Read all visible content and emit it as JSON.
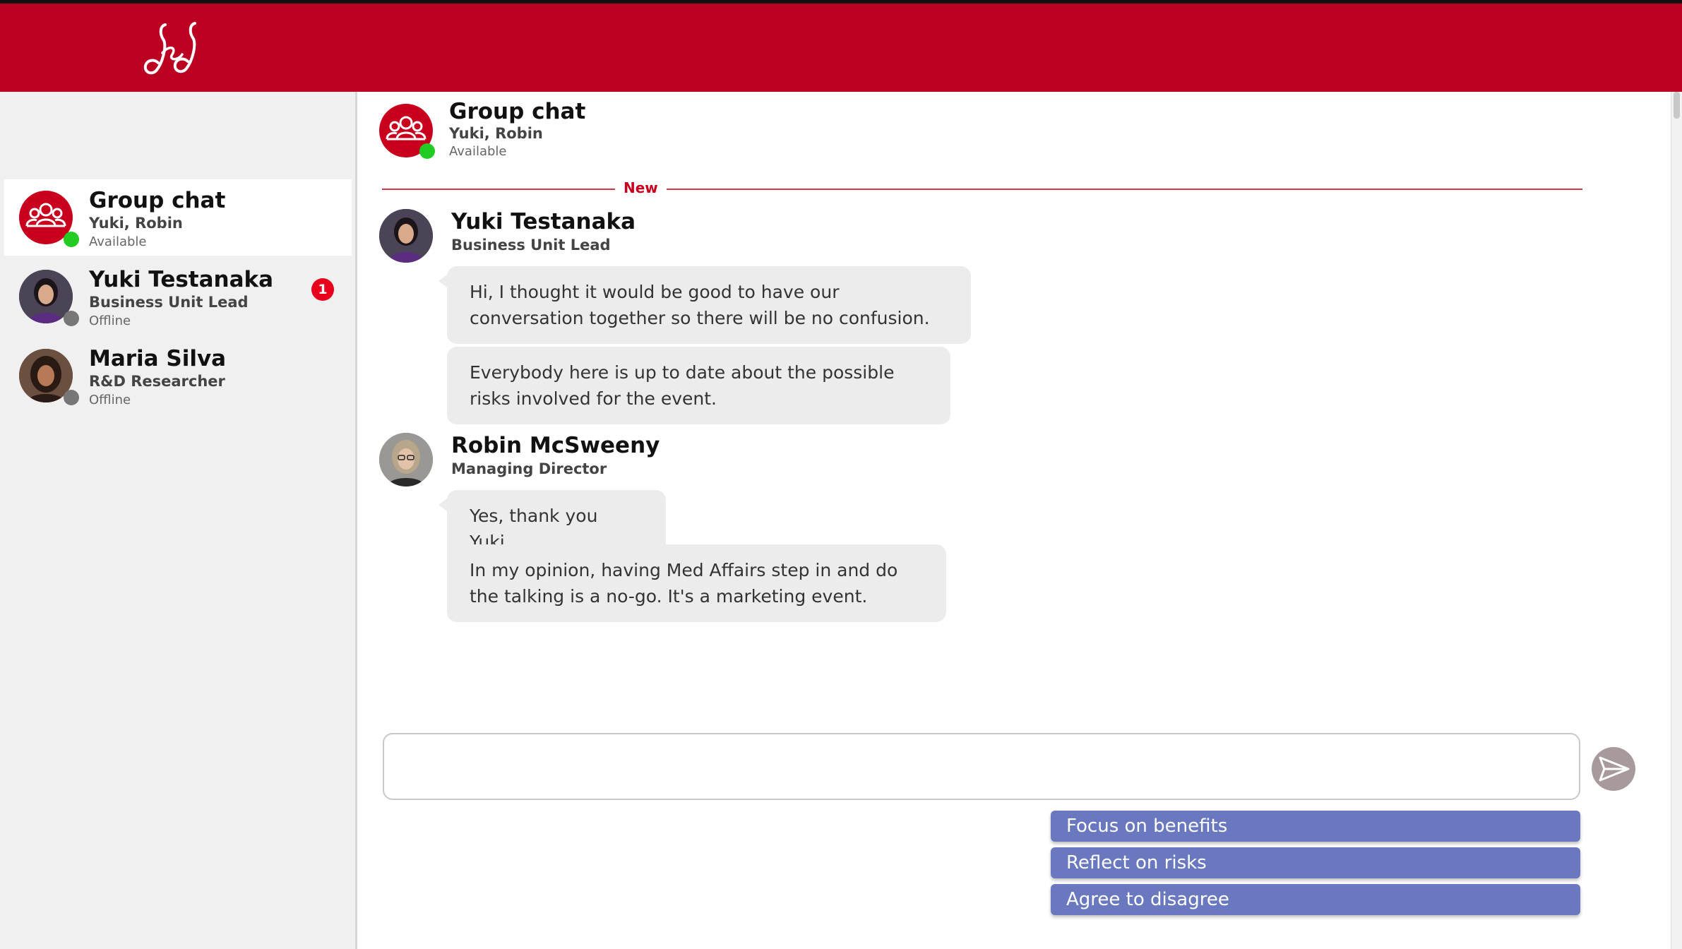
{
  "brand": {
    "logo_icon": "jnj-script-logo-icon",
    "header_color": "#bb0022",
    "accent_color": "#c8001e",
    "status_available_color": "#22cc22",
    "status_offline_color": "#777777"
  },
  "sidebar": {
    "conversations": [
      {
        "name": "Group chat",
        "subtitle": "Yuki, Robin",
        "status": "Available",
        "avatar_icon": "group-people-icon",
        "active": true
      },
      {
        "name": "Yuki Testanaka",
        "subtitle": "Business Unit Lead",
        "status": "Offline",
        "avatar_icon": "yuki-avatar",
        "unread": "1"
      },
      {
        "name": "Maria Silva",
        "subtitle": "R&D Researcher",
        "status": "Offline",
        "avatar_icon": "maria-avatar"
      }
    ]
  },
  "chat": {
    "header": {
      "name": "Group chat",
      "subtitle": "Yuki, Robin",
      "status": "Available"
    },
    "new_divider": "New",
    "groups": [
      {
        "sender": "Yuki Testanaka",
        "role": "Business Unit Lead",
        "messages": [
          "Hi, I thought it would be good to have our conversation together so there will be no confusion.",
          "Everybody here is up to date about the possible risks involved for the event."
        ]
      },
      {
        "sender": "Robin McSweeny",
        "role": "Managing Director",
        "messages": [
          "Yes, thank you Yuki.",
          "In my opinion, having Med Affairs step in and do the talking is a no-go. It's a marketing event."
        ]
      }
    ],
    "input": {
      "value": "",
      "placeholder": ""
    },
    "send_icon": "send-icon",
    "suggestions": [
      "Focus on benefits",
      "Reflect on risks",
      "Agree to disagree"
    ],
    "suggestion_color": "#6a79bf"
  }
}
